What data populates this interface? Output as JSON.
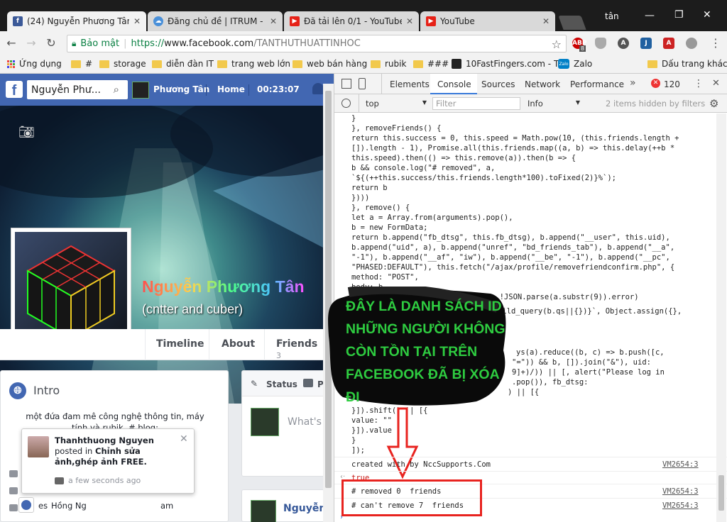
{
  "tabs": [
    {
      "title": "(24) Nguyễn Phương Tân",
      "icon": "facebook-icon",
      "active": true
    },
    {
      "title": "Đăng chủ đề | ITRUM - D",
      "icon": "itrum-icon",
      "active": false
    },
    {
      "title": "Đã tải lên 0/1 - YouTube",
      "icon": "youtube-icon",
      "active": false
    },
    {
      "title": "YouTube",
      "icon": "youtube-icon",
      "active": false
    }
  ],
  "window_user": "tân",
  "toolbar": {
    "secure_label": "Bảo mật",
    "url_scheme": "https://",
    "url_domain": "www.facebook.com",
    "url_path": "/TANTHUTHUATTINHOC",
    "abp_count": "8"
  },
  "bookmarks": [
    "Ứng dụng",
    "#",
    "storage",
    "diễn đàn IT",
    "trang web lớn",
    "web bán hàng",
    "rubik",
    "###",
    "10FastFingers.com - T",
    "Zalo"
  ],
  "bookmarks_other": "Dấu trang khác",
  "facebook": {
    "search_value": "Nguyễn Phư...",
    "nav_user": "Phương Tân",
    "nav_home": "Home",
    "nav_time": "00:23:07",
    "profile_name": "Nguyễn Phương Tân",
    "profile_subtitle": "(cntter and cuber)",
    "tabs": [
      "Timeline",
      "About",
      "Friends"
    ],
    "friends_count": "3",
    "intro_title": "Intro",
    "intro_text": "một đứa đam mê công nghệ thông tin, máy tính và rubik. # blog:",
    "status_tab": "Status",
    "status_placeholder": "What's",
    "post_author": "Nguyễn",
    "notif": {
      "name": "Thanhthuong Nguyen",
      "action": "posted in",
      "group": "Chỉnh sửa ảnh,ghép ảnh FREE.",
      "time": "a few seconds ago"
    },
    "bottom_left": "es",
    "bottom_name": "Hồng Ng",
    "bottom_time": "am"
  },
  "devtools": {
    "tabs": [
      "Elements",
      "Console",
      "Sources",
      "Network",
      "Performance"
    ],
    "active_tab": "Console",
    "error_count": "120",
    "context": "top",
    "filter_placeholder": "Filter",
    "level": "Info",
    "hidden_info": "2 items hidden by filters",
    "code_lines": [
      "}",
      "}, removeFriends() {",
      "return this.success = 0, this.speed = Math.pow(10, (this.friends.length +",
      "[]).length - 1), Promise.all(this.friends.map((a, b) => this.delay(++b *",
      "this.speed).then(() => this.remove(a)).then(b => {",
      "b && console.log(\"# removed\", a,",
      "`${(++this.success/this.friends.length*100).toFixed(2)}%`);",
      "return b",
      "})))",
      "}, remove() {",
      "let a = Array.from(arguments).pop(),",
      "b = new FormData;",
      "return b.append(\"fb_dtsg\", this.fb_dtsg), b.append(\"__user\", this.uid),",
      "b.append(\"uid\", a), b.append(\"unref\", \"bd_friends_tab\"), b.append(\"__a\",",
      "\"-1\"), b.append(\"__af\", \"iw\"), b.append(\"__be\", \"-1\"), b.append(\"__pc\",",
      "\"PHASED:DEFAULT\"), this.fetch(\"/ajax/profile/removefriendconfirm.php\", {",
      "method: \"POST\",",
      "body: b",
      "}).then(a => a.text()).then(a => !JSON.parse(a.substr(9)).error)"
    ],
    "code_fragments": [
      "uild_query(b.qs||{})}`, Object.assign({},",
      "ys(a).reduce((b, c) => b.push([c,",
      "\"=\")) && b, []).join(\"&\"), uid:",
      "9]+)/)) || [, alert(\"Please log in",
      ".pop()), fb_dtsg:",
      ") || [{"
    ],
    "code_tail": [
      "}]).shift() || [{",
      "value: \"\"",
      "}]).value",
      "}",
      "]);"
    ],
    "created_line": "created with by NccSupports.Com",
    "vm_link": "VM2654:3",
    "return_value": "true",
    "removed_line": "# removed 0  friends",
    "cant_remove_line": "# can't remove 7  friends"
  },
  "overlay_text": "ĐÂY LÀ DANH SÁCH ID  NHỮNG NGƯỜI KHÔNG CÒN TỒN TẠI TRÊN FACEBOOK ĐÃ BỊ XÓA ĐI",
  "colors": {
    "facebook_blue": "#4267b2",
    "overlay_green": "#2ecc40",
    "highlight_red": "#e8231f"
  }
}
